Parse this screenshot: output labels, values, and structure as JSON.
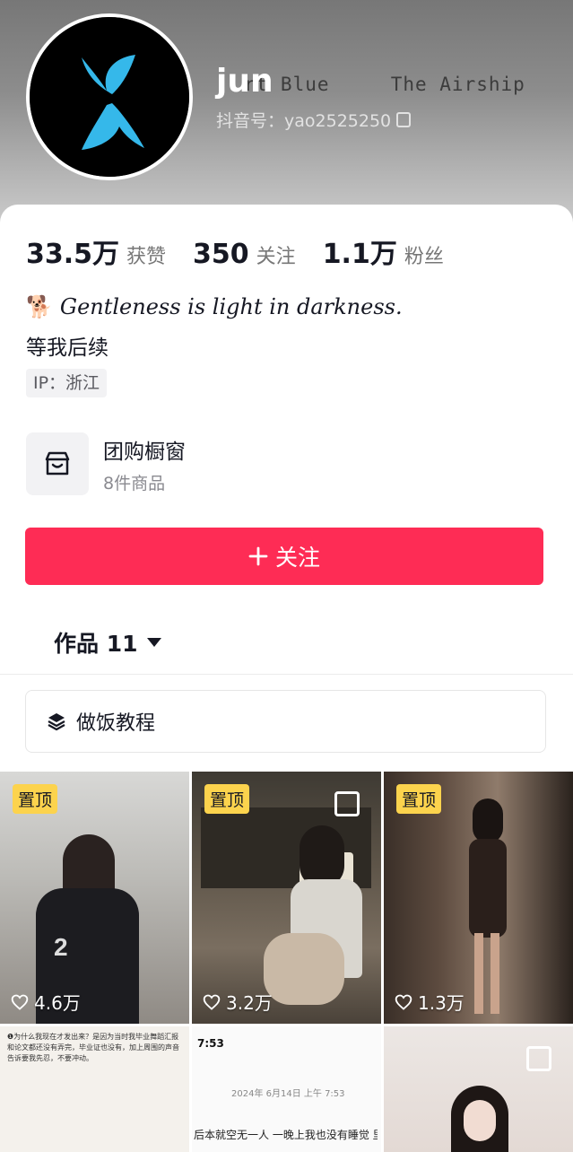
{
  "header": {
    "background_text": "rt Blue     The Airship",
    "username": "jun",
    "douyin_id": "抖音号：yao2525250"
  },
  "stats": [
    {
      "value": "33.5万",
      "label": "获赞"
    },
    {
      "value": "350",
      "label": "关注"
    },
    {
      "value": "1.1万",
      "label": "粉丝"
    }
  ],
  "bio": {
    "emoji": "🐕",
    "quote": "Gentleness is light in darkness.",
    "line2": "等我后续",
    "ip": "IP：浙江"
  },
  "shop": {
    "title": "团购橱窗",
    "subtitle": "8件商品"
  },
  "follow_button": "关注",
  "works_tab": "作品 11",
  "collection": "做饭教程",
  "videos": [
    {
      "pinned": "置顶",
      "likes": "4.6万",
      "multi": false
    },
    {
      "pinned": "置顶",
      "likes": "3.2万",
      "multi": true
    },
    {
      "pinned": "置顶",
      "likes": "1.3万",
      "multi": false
    },
    {
      "snippet": "❶为什么我现在才发出来？是因为当时我毕业舞蹈汇报和论文都还没有弄完，毕业证也没有，加上周围的声音告诉要我先忍，不要冲动。"
    },
    {
      "phone_time": "7:53",
      "snippet_date": "2024年 6月14日 上午 7:53",
      "snippet": "后本就空无一人 一晚上我也没有睡觉 里面"
    },
    {
      "multi": true
    }
  ],
  "colors": {
    "accent": "#fe2c55",
    "pin": "#fcd34d"
  }
}
